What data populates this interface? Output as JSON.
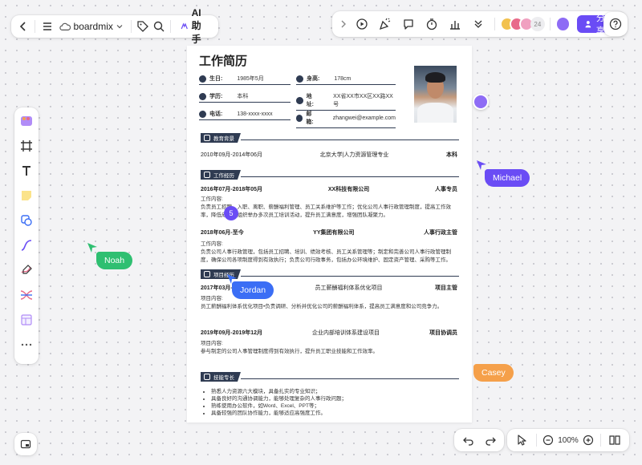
{
  "toolbar": {
    "brand": "boardmix",
    "ai_label": "AI助手",
    "share_label": "分享",
    "collaborator_count": "24"
  },
  "zoom": {
    "level": "100%"
  },
  "resume": {
    "title": "工作简历",
    "info": [
      {
        "label": "生日:",
        "value": "1985年5月"
      },
      {
        "label": "身高:",
        "value": "178cm"
      },
      {
        "label": "学历:",
        "value": "本科"
      },
      {
        "label": "地址:",
        "value": "XX省XX市XX区XX路XX号"
      },
      {
        "label": "电话:",
        "value": "138-xxxx-xxxx"
      },
      {
        "label": "邮箱:",
        "value": "zhangwei@example.com"
      }
    ],
    "education": {
      "header": "教育背景",
      "period": "2010年09月-2014年06月",
      "school": "北京大学|人力资源管理专业",
      "degree": "本科"
    },
    "work": {
      "header": "工作经历",
      "jobs": [
        {
          "period": "2016年07月-2018年05月",
          "company": "XX科技有限公司",
          "title": "人事专员",
          "label": "工作内容:",
          "content": "负责员工招聘、入职、离职、薪酬福利管理、员工关系维护等工作；优化公司人事行政管理制度，提高工作效率，降低成本；组织举办多次员工培训活动，提升员工满意度，增强团队凝聚力。"
        },
        {
          "period": "2018年06月-至今",
          "company": "YY集团有限公司",
          "title": "人事行政主管",
          "label": "工作内容:",
          "content": "负责公司人事行政管理，包括员工招聘、培训、绩效考核、员工关系管理等；制定和完善公司人事行政管理制度，确保公司各项制度得到有效执行；负责公司行政事务，包括办公环境维护、固定资产管理、采购等工作。"
        }
      ]
    },
    "projects": {
      "header": "项目经历",
      "items": [
        {
          "period": "2017年03月-2017年12月",
          "name": "员工薪酬福利体系优化项目",
          "role": "项目主管",
          "label": "项目内容:",
          "content": "员工薪酬福利体系优化项目•负责调研、分析并优化公司的薪酬福利体系，提高员工满意度和公司竞争力。"
        },
        {
          "period": "2019年09月-2019年12月",
          "name": "企业内部培训体系建设项目",
          "role": "项目协调员",
          "label": "项目内容:",
          "content": "参与制定的公司人事管理制度得到有效执行，提升员工职业技能和工作效率。"
        }
      ]
    },
    "skills": {
      "header": "技能专长",
      "items": [
        "熟悉人力资源六大模块，具备扎实的专业知识；",
        "具备良好的沟通协调能力，能够处理复杂的人事行政问题；",
        "熟练使用办公软件，如Word、Excel、PPT等；",
        "具备较强的团队协作能力，能够适应高强度工作。"
      ]
    }
  },
  "collaborators": {
    "noah": {
      "name": "Noah",
      "color": "#2fbf71"
    },
    "michael": {
      "name": "Michael",
      "color": "#6a4cf5"
    },
    "jordan": {
      "name": "Jordan",
      "color": "#3b6ef5"
    },
    "casey": {
      "name": "Casey",
      "color": "#f5a04a"
    }
  },
  "badge": "5"
}
